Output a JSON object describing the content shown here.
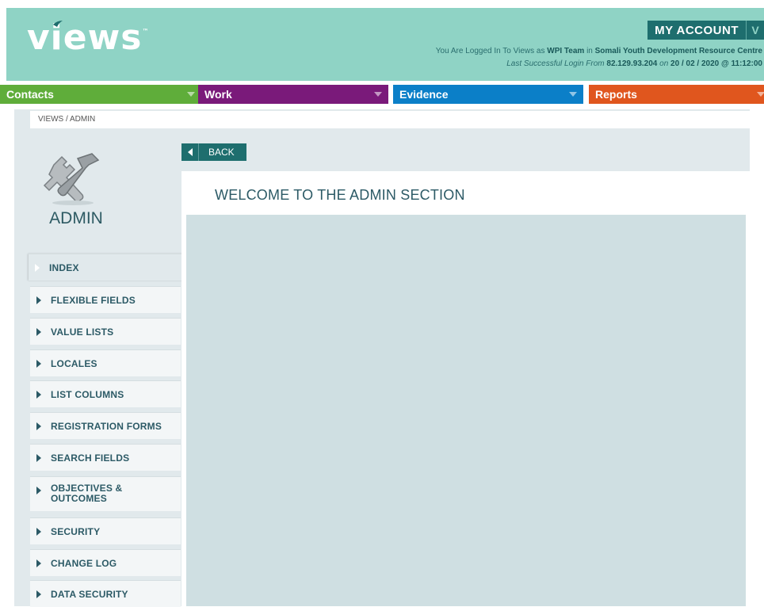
{
  "header": {
    "logo": "views",
    "logo_tm": "™",
    "account_label": "MY ACCOUNT",
    "account_chevron": "V",
    "login_prefix": "You Are Logged In To Views as ",
    "login_user": "WPI Team",
    "login_in": " in ",
    "login_org": "Somali Youth Development Resource Centre",
    "last_prefix": "Last Successful Login From ",
    "last_ip": "82.129.93.204",
    "last_on": " on ",
    "last_datetime": "20 / 02 / 2020 @ 11:12:00"
  },
  "nav": [
    {
      "label": "Contacts",
      "color": "#5fad3a"
    },
    {
      "label": "Work",
      "color": "#7a1a7a"
    },
    {
      "label": "Evidence",
      "color": "#0b7fc8"
    },
    {
      "label": "Reports",
      "color": "#e0561e"
    }
  ],
  "breadcrumb": "VIEWS / ADMIN",
  "sidebar": {
    "title": "ADMIN",
    "icon": "tools-icon",
    "items": [
      {
        "label": "INDEX",
        "active": true
      },
      {
        "label": "FLEXIBLE FIELDS"
      },
      {
        "label": "VALUE LISTS"
      },
      {
        "label": "LOCALES"
      },
      {
        "label": "LIST COLUMNS"
      },
      {
        "label": "REGISTRATION FORMS"
      },
      {
        "label": "SEARCH FIELDS"
      },
      {
        "label": "OBJECTIVES & OUTCOMES"
      },
      {
        "label": "SECURITY"
      },
      {
        "label": "CHANGE LOG"
      },
      {
        "label": "DATA SECURITY"
      }
    ]
  },
  "main": {
    "back_label": "BACK",
    "title": "WELCOME TO THE ADMIN SECTION"
  },
  "colors": {
    "header_bg": "#8fd3c5",
    "accent_dark": "#1e6e6e",
    "text_teal": "#2c5a66",
    "content_bg": "#e1e9ec",
    "panel_body": "#cfdfe2"
  }
}
